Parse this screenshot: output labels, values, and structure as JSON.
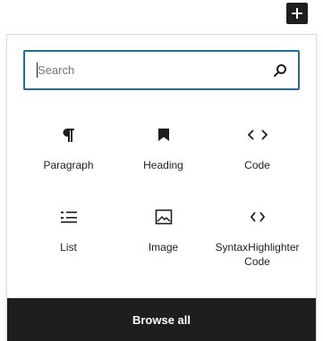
{
  "toolbar": {
    "toggle_icon": "plus-icon"
  },
  "search": {
    "placeholder": "Search",
    "value": "",
    "icon": "search-icon"
  },
  "blocks": [
    {
      "label": "Paragraph",
      "icon": "paragraph-icon"
    },
    {
      "label": "Heading",
      "icon": "bookmark-icon"
    },
    {
      "label": "Code",
      "icon": "code-icon"
    },
    {
      "label": "List",
      "icon": "list-icon"
    },
    {
      "label": "Image",
      "icon": "image-icon"
    },
    {
      "label": "SyntaxHighlighter Code",
      "icon": "code-icon"
    }
  ],
  "footer": {
    "browse_all_label": "Browse all"
  },
  "colors": {
    "dark": "#1e1e1e",
    "accent": "#1e6f98",
    "border": "#dcdcde"
  }
}
